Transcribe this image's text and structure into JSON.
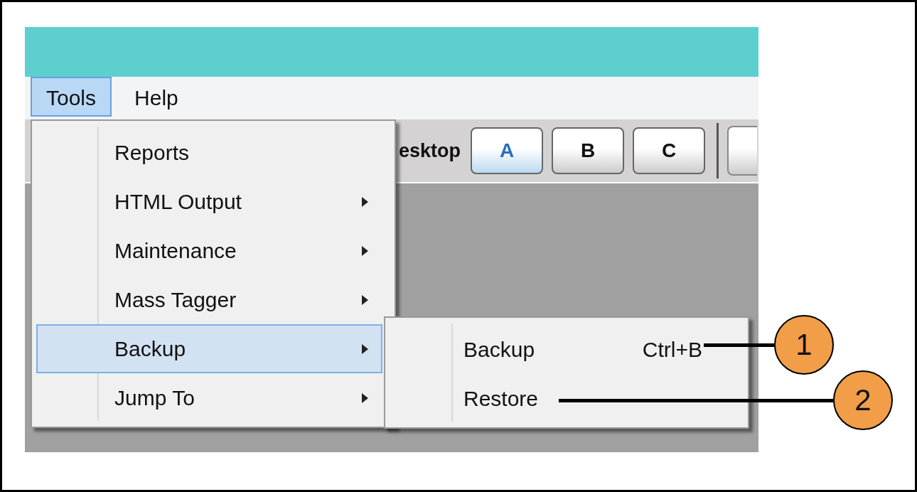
{
  "menubar": [
    {
      "label": "Tools",
      "selected": true
    },
    {
      "label": "Help",
      "selected": false
    }
  ],
  "toolbar": {
    "label": "esktop",
    "buttons": [
      {
        "label": "A",
        "selected": true
      },
      {
        "label": "B",
        "selected": false
      },
      {
        "label": "C",
        "selected": false
      }
    ]
  },
  "tools_menu": [
    {
      "label": "Reports",
      "submenu": false,
      "selected": false
    },
    {
      "label": "HTML Output",
      "submenu": true,
      "selected": false
    },
    {
      "label": "Maintenance",
      "submenu": true,
      "selected": false
    },
    {
      "label": "Mass Tagger",
      "submenu": true,
      "selected": false
    },
    {
      "label": "Backup",
      "submenu": true,
      "selected": true
    },
    {
      "label": "Jump To",
      "submenu": true,
      "selected": false
    }
  ],
  "backup_submenu": [
    {
      "label": "Backup",
      "shortcut": "Ctrl+B"
    },
    {
      "label": "Restore"
    }
  ],
  "callouts": [
    {
      "number": "1"
    },
    {
      "number": "2"
    }
  ]
}
